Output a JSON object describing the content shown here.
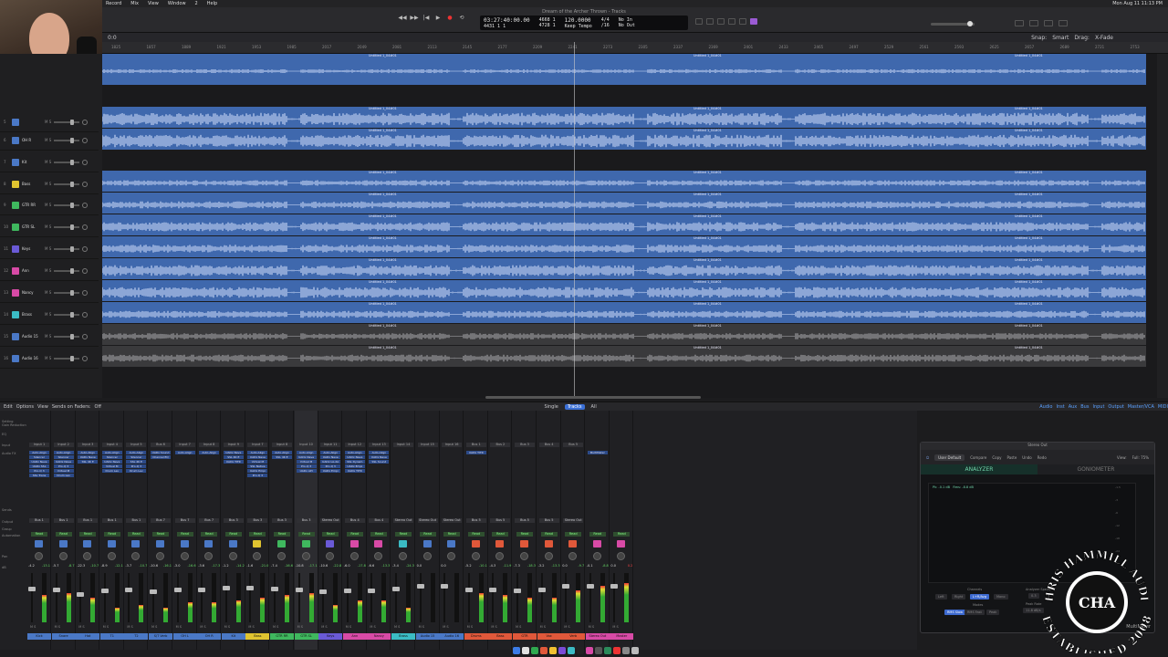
{
  "menubar": {
    "items": [
      "Record",
      "Mix",
      "View",
      "Window",
      "2",
      "Help"
    ],
    "clock": "Mon Aug 11  11:13 PM"
  },
  "window": {
    "title": "Dream of the Archer Thrown - Tracks"
  },
  "transport": {
    "position_main": "03:27:40:00.00",
    "position_sub": "4431   1   1",
    "bars_top": "4668   1",
    "bars_bottom": "4728   1",
    "beat_top": "1   1",
    "tempo": "120.0000",
    "tempo_mode": "Keep Tempo",
    "signature": "4/4",
    "division": "/16",
    "midi_in": "No In",
    "midi_out": "No Out",
    "buttons": [
      "rewind",
      "forward",
      "stop",
      "play",
      "record",
      "cycle"
    ]
  },
  "tracks_toolbar": {
    "zoom": "0:0",
    "snap_label": "Snap:",
    "snap": "Smart",
    "drag_label": "Drag:",
    "drag": "X-Fade"
  },
  "ruler_ticks": [
    "1825",
    "1857",
    "1889",
    "1921",
    "1953",
    "1985",
    "2017",
    "2049",
    "2081",
    "2113",
    "2145",
    "2177",
    "2209",
    "2241",
    "2273",
    "2305",
    "2337",
    "2369",
    "2401",
    "2433",
    "2465",
    "2497",
    "2529",
    "2561",
    "2593",
    "2625",
    "2657",
    "2689",
    "2721",
    "2753"
  ],
  "tracks": [
    {
      "num": "5",
      "name": "",
      "color": "#4a78c6"
    },
    {
      "num": "6",
      "name": "OH R",
      "color": "#4a78c6"
    },
    {
      "num": "7",
      "name": "Kit",
      "color": "#4a78c6"
    },
    {
      "num": "8",
      "name": "Bass",
      "color": "#e0c430"
    },
    {
      "num": "9",
      "name": "GTR RR",
      "color": "#3fb85e"
    },
    {
      "num": "10",
      "name": "GTR SL",
      "color": "#3fb85e"
    },
    {
      "num": "11",
      "name": "Keys",
      "color": "#6a5ad6"
    },
    {
      "num": "12",
      "name": "Ann",
      "color": "#d84aa6"
    },
    {
      "num": "13",
      "name": "Nancy",
      "color": "#d84aa6"
    },
    {
      "num": "14",
      "name": "Brass",
      "color": "#3bbbc4"
    },
    {
      "num": "15",
      "name": "Audio 15",
      "color": "#4a78c6"
    },
    {
      "num": "16",
      "name": "Audio 16",
      "color": "#4a78c6"
    }
  ],
  "region_label": "Untitled 1_04#01",
  "mixer_bar": {
    "menus": [
      "Edit",
      "Options",
      "View"
    ],
    "sends_on_faders": "Sends on Faders:",
    "sends_value": "Off",
    "modes": [
      "Single",
      "Tracks",
      "All"
    ],
    "active_mode": "Tracks",
    "filters": [
      "Audio",
      "Inst",
      "Aux",
      "Bus",
      "Input",
      "Output",
      "Master/VCA",
      "MIDI"
    ]
  },
  "mixer_row_labels": [
    "Setting",
    "Gain Reduction",
    "EQ",
    "Input",
    "Audio FX",
    "Sends",
    "Output",
    "Group",
    "Automation",
    "Pan",
    "dB"
  ],
  "strips": [
    {
      "name": "Kick",
      "color": "#4a78c6",
      "in": "Input 1",
      "out": "Bus 1",
      "db": "-4.2",
      "pk": "-13.1",
      "fx": [
        "Auto-Align",
        "Silencer",
        "UADx Neve",
        "UADx SSL",
        "Pro-Q 3",
        "SSL Trans"
      ],
      "meter": 0.55,
      "fader": 0.72
    },
    {
      "name": "Snare",
      "color": "#4a78c6",
      "in": "Input 2",
      "out": "Bus 1",
      "db": "-5.7",
      "pk": "-8.7",
      "fx": [
        "Auto-Align",
        "Silencer",
        "UADx Neve",
        "Pro-Q 3",
        "Virtual M",
        "Drum Lev"
      ],
      "meter": 0.6,
      "fader": 0.7
    },
    {
      "name": "Hat",
      "color": "#4a78c6",
      "in": "Input 3",
      "out": "Bus 1",
      "db": "-22.3",
      "pk": "-10.7",
      "fx": [
        "Auto-Align",
        "UADx Neve",
        "SSL 4K E"
      ],
      "meter": 0.5,
      "fader": 0.62
    },
    {
      "name": "T1",
      "color": "#4a78c6",
      "in": "Input 4",
      "out": "Bus 1",
      "db": "-8.9",
      "pk": "-12.1",
      "fx": [
        "Auto-Align",
        "Silencer",
        "UADx Neve",
        "Virtual M",
        "Drum Lev"
      ],
      "meter": 0.3,
      "fader": 0.68
    },
    {
      "name": "T2",
      "color": "#4a78c6",
      "in": "Input 5",
      "out": "Bus 1",
      "db": "-3.7",
      "pk": "-10.7",
      "fx": [
        "Auto-Align",
        "Silencer",
        "SSL 4K E",
        "Pro-Q 3",
        "Drum Lev"
      ],
      "meter": 0.35,
      "fader": 0.7
    },
    {
      "name": "S/T Verb",
      "color": "#4a78c6",
      "in": "Bus 6",
      "out": "Bus 7",
      "db": "-10.6",
      "pk": "-16.1",
      "fx": [
        "UADx Sound",
        "Channel EQ"
      ],
      "meter": 0.3,
      "fader": 0.66
    },
    {
      "name": "OH L",
      "color": "#4a78c6",
      "in": "Input 7",
      "out": "Bus 7",
      "db": "-3.0",
      "pk": "-16.6",
      "fx": [
        "Auto-Align"
      ],
      "meter": 0.4,
      "fader": 0.7
    },
    {
      "name": "OH R",
      "color": "#4a78c6",
      "in": "Input 8",
      "out": "Bus 7",
      "db": "-3.6",
      "pk": "-17.3",
      "fx": [
        "Auto-Align"
      ],
      "meter": 0.4,
      "fader": 0.7
    },
    {
      "name": "Kit",
      "color": "#4a78c6",
      "in": "Input 9",
      "out": "Bus 3",
      "db": "-1.2",
      "pk": "-14.2",
      "fx": [
        "UADx Neve",
        "SSL 4K E",
        "UADx TITR"
      ],
      "meter": 0.45,
      "fader": 0.74
    },
    {
      "name": "Bass",
      "color": "#e0c430",
      "in": "Input 7",
      "out": "Bus 3",
      "db": "-1.6",
      "pk": "-21.0",
      "fx": [
        "Auto-Align",
        "UADx Neve",
        "Virtual M",
        "SSL Native",
        "UADx Empi",
        "Pro-Q 3"
      ],
      "meter": 0.5,
      "fader": 0.74
    },
    {
      "name": "GTR RR",
      "color": "#3fb85e",
      "in": "Input 8",
      "out": "Bus 3",
      "db": "-7.4",
      "pk": "-16.6",
      "fx": [
        "Auto-Align",
        "SSL 4K E"
      ],
      "meter": 0.55,
      "fader": 0.72
    },
    {
      "name": "GTR SL",
      "color": "#3fb85e",
      "in": "Input 10",
      "out": "Bus 3",
      "db": "-10.8",
      "pk": "-17.1",
      "fx": [
        "Auto-Align",
        "UADx Neve",
        "Virtual M",
        "Pro-Q 3",
        "UADx API"
      ],
      "meter": 0.6,
      "fader": 0.7,
      "sel": true
    },
    {
      "name": "Keys",
      "color": "#6a5ad6",
      "in": "Input 11",
      "out": "Stereo Out",
      "db": "-10.6",
      "pk": "-22.8",
      "fx": [
        "Auto-Align",
        "UADx Neve",
        "UADx LA-2A",
        "Pro-Q 3",
        "UADx Empi"
      ],
      "meter": 0.35,
      "fader": 0.66
    },
    {
      "name": "Ann",
      "color": "#d84aa6",
      "in": "Input 12",
      "out": "Bus 4",
      "db": "-6.0",
      "pk": "-17.8",
      "fx": [
        "Auto-Align",
        "UADx Neve",
        "SSL Dynam",
        "UADx Empi",
        "UADx TITR"
      ],
      "meter": 0.45,
      "fader": 0.68
    },
    {
      "name": "Nancy",
      "color": "#d84aa6",
      "in": "Input 13",
      "out": "Bus 4",
      "db": "-6.6",
      "pk": "-13.3",
      "fx": [
        "Auto-Align",
        "UADx Neve",
        "SSL Sound"
      ],
      "meter": 0.45,
      "fader": 0.68
    },
    {
      "name": "Brass",
      "color": "#3bbbc4",
      "in": "Input 14",
      "out": "Stereo Out",
      "db": "-3.4",
      "pk": "-24.3",
      "fx": [],
      "meter": 0.3,
      "fader": 0.72
    },
    {
      "name": "Audio 15",
      "color": "#4a78c6",
      "in": "Input 15",
      "out": "Stereo Out",
      "db": "0.0",
      "pk": "",
      "fx": [],
      "meter": 0.0,
      "fader": 0.78
    },
    {
      "name": "Audio 16",
      "color": "#4a78c6",
      "in": "Input 16",
      "out": "Stereo Out",
      "db": "0.0",
      "pk": "",
      "fx": [],
      "meter": 0.0,
      "fader": 0.78
    },
    {
      "name": "Drums",
      "color": "#e0583a",
      "in": "Bus 1",
      "out": "Bus 5",
      "db": "-5.2",
      "pk": "-10.1",
      "fx": [
        "UADx TITR"
      ],
      "meter": 0.6,
      "fader": 0.7
    },
    {
      "name": "Bass",
      "color": "#e0583a",
      "in": "Bus 2",
      "out": "Bus 5",
      "db": "-4.3",
      "pk": "-11.9",
      "fx": [],
      "meter": 0.55,
      "fader": 0.7
    },
    {
      "name": "GTR",
      "color": "#e0583a",
      "in": "Bus 3",
      "out": "Bus 5",
      "db": "-7.3",
      "pk": "-18.3",
      "fx": [],
      "meter": 0.5,
      "fader": 0.68
    },
    {
      "name": "Vox",
      "color": "#e0583a",
      "in": "Bus 4",
      "out": "Bus 5",
      "db": "-3.2",
      "pk": "-13.3",
      "fx": [],
      "meter": 0.5,
      "fader": 0.7
    },
    {
      "name": "Verb",
      "color": "#e0583a",
      "in": "Bus 5",
      "out": "Stereo Out",
      "db": "0.0",
      "pk": "-9.7",
      "fx": [],
      "meter": 0.65,
      "fader": 0.78
    },
    {
      "name": "Stereo Out",
      "color": "#d84aa6",
      "in": "",
      "out": "",
      "db": "-0.1",
      "pk": "-8.8",
      "fx": [
        "MultiMeter"
      ],
      "meter": 0.75,
      "fader": 0.78
    },
    {
      "name": "Master",
      "color": "#d84aa6",
      "in": "",
      "out": "",
      "db": "0.0",
      "pk": "0.2",
      "fx": [],
      "meter": 0.8,
      "fader": 0.78,
      "hot": true
    }
  ],
  "plugin": {
    "title": "Stereo Out",
    "preset": "User Default",
    "toolbar": [
      "Compare",
      "Copy",
      "Paste",
      "Undo",
      "Redo"
    ],
    "view_label": "View:",
    "view": "Full: 75%",
    "tabs": [
      "ANALYZER",
      "GONIOMETER"
    ],
    "active_tab": "ANALYZER",
    "legend_peak": "Pk: -0.1 dB",
    "legend_rms": "Rms: -8.8 dB",
    "scale": [
      "-1.5",
      "-3",
      "-6",
      "-12",
      "-18",
      "-24"
    ],
    "bottom": {
      "channels_label": "Channels",
      "channels": [
        "Left",
        "Right",
        "L+R/Avg",
        "Mono"
      ],
      "active_channel": "L+R/Avg",
      "modes_label": "Modes",
      "modes": [
        "RMS Slow",
        "RMS Fast",
        "Peak"
      ],
      "active_mode": "RMS Slow",
      "speed_label": "Analyzer Speed",
      "speed": "0.3",
      "release_label": "Peak Rate",
      "release": "11.8 dB/s"
    },
    "brand": "MultiMeter"
  },
  "watermark": {
    "arc_top": "CHRIS HAMMILL AUDIO",
    "arc_bottom": "ESTABLISHED 2008",
    "center": "CHA"
  }
}
